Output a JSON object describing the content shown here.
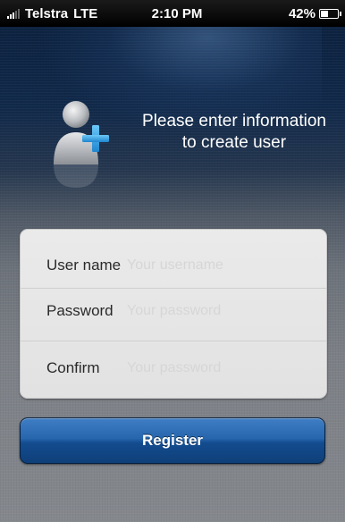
{
  "status_bar": {
    "carrier": "Telstra",
    "network": "LTE",
    "time": "2:10 PM",
    "battery": "42%",
    "battery_level": 0.42
  },
  "header": {
    "line1": "Please enter information",
    "line2": "to create user",
    "icon": "add-user-icon"
  },
  "form": {
    "username_label": "User name",
    "username_placeholder": "Your username",
    "password_label": "Password",
    "password_placeholder": "Your password",
    "confirm_label": "Confirm",
    "confirm_placeholder": "Your password"
  },
  "register_label": "Register",
  "colors": {
    "accent": "#2766ad",
    "plus": "#3aa7e6"
  }
}
